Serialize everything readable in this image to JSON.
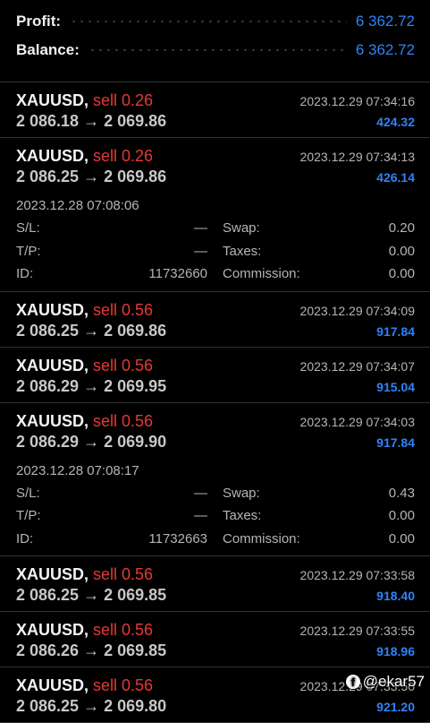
{
  "summary": {
    "profit_label": "Profit:",
    "profit_value": "6 362.72",
    "balance_label": "Balance:",
    "balance_value": "6 362.72"
  },
  "labels": {
    "sl": "S/L:",
    "tp": "T/P:",
    "id": "ID:",
    "swap": "Swap:",
    "taxes": "Taxes:",
    "commission": "Commission:",
    "dash": "—",
    "arrow": "→"
  },
  "trades": [
    {
      "symbol": "XAUUSD,",
      "side": "sell 0.26",
      "open": "2 086.18",
      "close": "2 069.86",
      "time": "2023.12.29 07:34:16",
      "profit": "424.32"
    },
    {
      "symbol": "XAUUSD,",
      "side": "sell 0.26",
      "open": "2 086.25",
      "close": "2 069.86",
      "time": "2023.12.29 07:34:13",
      "profit": "426.14",
      "details": {
        "open_time": "2023.12.28 07:08:06",
        "sl": "—",
        "tp": "—",
        "id": "11732660",
        "swap": "0.20",
        "taxes": "0.00",
        "commission": "0.00"
      }
    },
    {
      "symbol": "XAUUSD,",
      "side": "sell 0.56",
      "open": "2 086.25",
      "close": "2 069.86",
      "time": "2023.12.29 07:34:09",
      "profit": "917.84"
    },
    {
      "symbol": "XAUUSD,",
      "side": "sell 0.56",
      "open": "2 086.29",
      "close": "2 069.95",
      "time": "2023.12.29 07:34:07",
      "profit": "915.04"
    },
    {
      "symbol": "XAUUSD,",
      "side": "sell 0.56",
      "open": "2 086.29",
      "close": "2 069.90",
      "time": "2023.12.29 07:34:03",
      "profit": "917.84",
      "details": {
        "open_time": "2023.12.28 07:08:17",
        "sl": "—",
        "tp": "—",
        "id": "11732663",
        "swap": "0.43",
        "taxes": "0.00",
        "commission": "0.00"
      }
    },
    {
      "symbol": "XAUUSD,",
      "side": "sell 0.56",
      "open": "2 086.25",
      "close": "2 069.85",
      "time": "2023.12.29 07:33:58",
      "profit": "918.40"
    },
    {
      "symbol": "XAUUSD,",
      "side": "sell 0.56",
      "open": "2 086.26",
      "close": "2 069.85",
      "time": "2023.12.29 07:33:55",
      "profit": "918.96"
    },
    {
      "symbol": "XAUUSD,",
      "side": "sell 0.56",
      "open": "2 086.25",
      "close": "2 069.80",
      "time": "2023.12.29 07:33:50",
      "profit": "921.20"
    }
  ],
  "watermark": {
    "icon": "facebook-icon",
    "text": "@ekar57"
  }
}
